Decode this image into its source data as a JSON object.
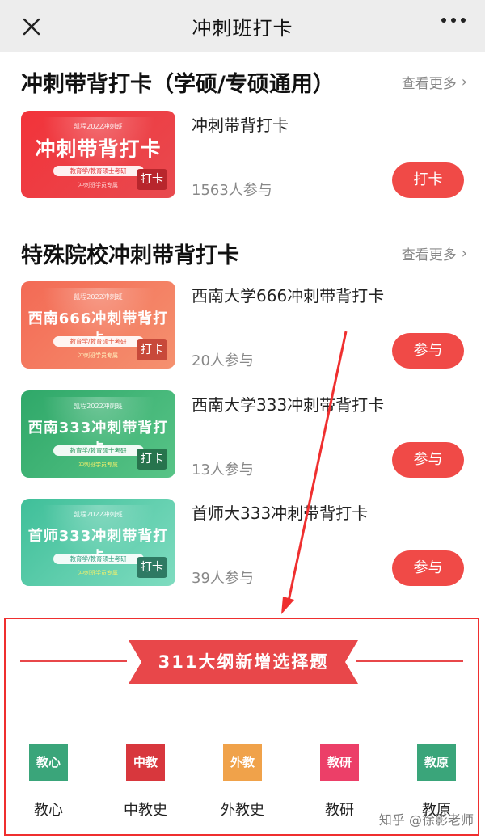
{
  "topbar": {
    "title": "冲刺班打卡",
    "close_icon": "close-icon",
    "more_icon": "more-dots-icon"
  },
  "sections": [
    {
      "title": "冲刺带背打卡（学硕/专硕通用）",
      "see_more": "查看更多",
      "items": [
        {
          "thumb_brand": "凯程2022冲刺班",
          "thumb_title": "冲刺带背打卡",
          "thumb_pill": "教育学/教育硕士考研",
          "thumb_foot": "冲刺班学员专属",
          "thumb_tag": "打卡",
          "name": "冲刺带背打卡",
          "count": "1563人参与",
          "action": "打卡",
          "color_from": "#f2333a",
          "color_to": "#e84a4f"
        }
      ]
    },
    {
      "title": "特殊院校冲刺带背打卡",
      "see_more": "查看更多",
      "items": [
        {
          "thumb_brand": "凯程2022冲刺班",
          "thumb_title": "西南666冲刺带背打卡",
          "thumb_pill": "教育学/教育硕士考研",
          "thumb_foot": "冲刺班学员专属",
          "thumb_tag": "打卡",
          "name": "西南大学666冲刺带背打卡",
          "count": "20人参与",
          "action": "参与",
          "color_from": "#f36a55",
          "color_to": "#f5916f"
        },
        {
          "thumb_brand": "凯程2022冲刺班",
          "thumb_title": "西南333冲刺带背打卡",
          "thumb_pill": "教育学/教育硕士考研",
          "thumb_foot": "冲刺班学员专属",
          "thumb_tag": "打卡",
          "name": "西南大学333冲刺带背打卡",
          "count": "13人参与",
          "action": "参与",
          "color_from": "#2fa869",
          "color_to": "#58c487"
        },
        {
          "thumb_brand": "凯程2022冲刺班",
          "thumb_title": "首师333冲刺带背打卡",
          "thumb_pill": "教育学/教育硕士考研",
          "thumb_foot": "冲刺班学员专属",
          "thumb_tag": "打卡",
          "name": "首师大333冲刺带背打卡",
          "count": "39人参与",
          "action": "参与",
          "color_from": "#3fbf99",
          "color_to": "#7fdcc0"
        }
      ]
    }
  ],
  "promo": {
    "banner": "311大纲新增选择题",
    "categories": [
      {
        "box": "教心",
        "label": "教心",
        "color": "#3aa57a"
      },
      {
        "box": "中教",
        "label": "中教史",
        "color": "#d8373d"
      },
      {
        "box": "外教",
        "label": "外教史",
        "color": "#f0a24a"
      },
      {
        "box": "教研",
        "label": "教研",
        "color": "#ec3f68"
      },
      {
        "box": "教原",
        "label": "教原",
        "color": "#3aa57a"
      }
    ]
  },
  "watermark": "知乎 @徐影老师",
  "colors": {
    "accent": "#f04a47",
    "annotation": "#ef2f2f"
  }
}
